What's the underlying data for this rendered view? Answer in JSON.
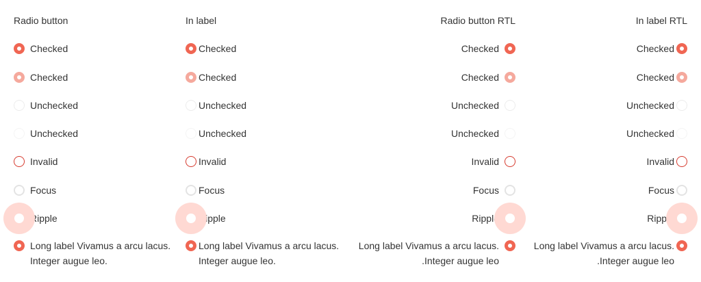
{
  "columns": [
    {
      "heading": "Radio button",
      "items": [
        {
          "label": "Checked",
          "state": "checked"
        },
        {
          "label": "Checked",
          "state": "checked-dim"
        },
        {
          "label": "Unchecked",
          "state": "unchecked"
        },
        {
          "label": "Unchecked",
          "state": "unchecked-light"
        },
        {
          "label": "Invalid",
          "state": "invalid"
        },
        {
          "label": "Focus",
          "state": "focus"
        },
        {
          "label": "Ripple",
          "state": "ripple"
        },
        {
          "label": "Long label Vivamus a arcu lacus. Integer augue leo.",
          "state": "checked"
        }
      ]
    },
    {
      "heading": "In label",
      "items": [
        {
          "label": "Checked",
          "state": "checked"
        },
        {
          "label": "Checked",
          "state": "checked-dim"
        },
        {
          "label": "Unchecked",
          "state": "unchecked"
        },
        {
          "label": "Unchecked",
          "state": "unchecked-light"
        },
        {
          "label": "Invalid",
          "state": "invalid"
        },
        {
          "label": "Focus",
          "state": "focus"
        },
        {
          "label": "Ripple",
          "state": "ripple"
        },
        {
          "label": "Long label Vivamus a arcu lacus. Integer augue leo.",
          "state": "checked"
        }
      ]
    },
    {
      "heading": "Radio button RTL",
      "items": [
        {
          "label": "Checked",
          "state": "checked"
        },
        {
          "label": "Checked",
          "state": "checked-dim"
        },
        {
          "label": "Unchecked",
          "state": "unchecked"
        },
        {
          "label": "Unchecked",
          "state": "unchecked-light"
        },
        {
          "label": "Invalid",
          "state": "invalid"
        },
        {
          "label": "Focus",
          "state": "focus"
        },
        {
          "label": "Ripple",
          "state": "ripple"
        },
        {
          "label": "Long label Vivamus a arcu lacus. .Integer augue leo",
          "state": "checked"
        }
      ]
    },
    {
      "heading": "In label RTL",
      "items": [
        {
          "label": "Checked",
          "state": "checked"
        },
        {
          "label": "Checked",
          "state": "checked-dim"
        },
        {
          "label": "Unchecked",
          "state": "unchecked"
        },
        {
          "label": "Unchecked",
          "state": "unchecked-light"
        },
        {
          "label": "Invalid",
          "state": "invalid"
        },
        {
          "label": "Focus",
          "state": "focus"
        },
        {
          "label": "Ripple",
          "state": "ripple"
        },
        {
          "label": "Long label Vivamus a arcu lacus. .Integer augue leo",
          "state": "checked"
        }
      ]
    }
  ],
  "colors": {
    "accent": "#f06653",
    "accent_dim": "#f5a99d",
    "invalid": "#d63a2e",
    "ripple": "#ffd9d3"
  }
}
